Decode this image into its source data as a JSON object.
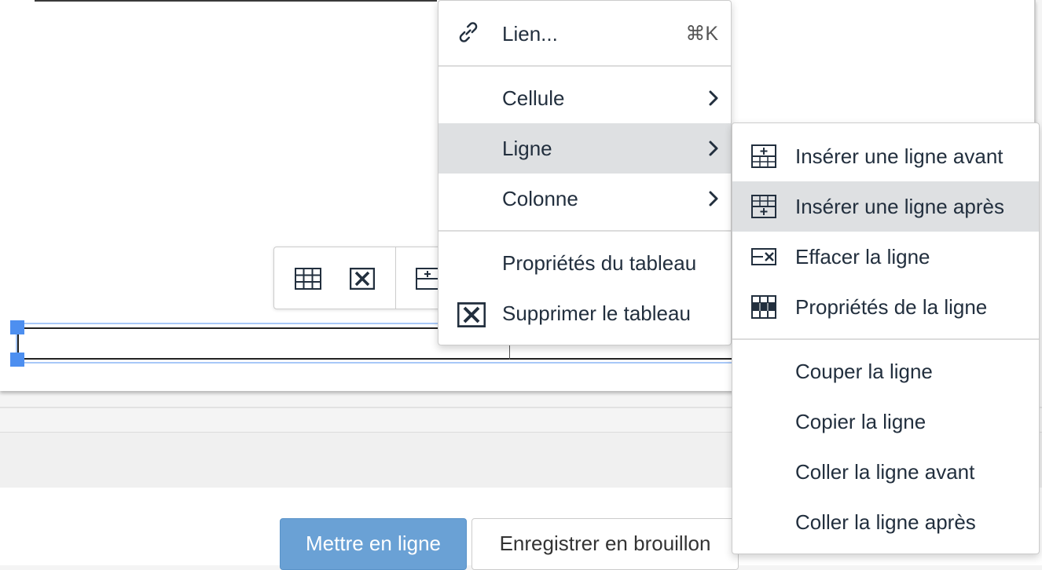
{
  "context_menu": {
    "link": {
      "label": "Lien...",
      "shortcut": "⌘K",
      "icon": "link-icon"
    },
    "cell": {
      "label": "Cellule"
    },
    "row": {
      "label": "Ligne"
    },
    "column": {
      "label": "Colonne"
    },
    "table_properties": {
      "label": "Propriétés du tableau"
    },
    "delete_table": {
      "label": "Supprimer le tableau",
      "icon": "table-delete-icon"
    }
  },
  "row_submenu": {
    "insert_before": {
      "label": "Insérer une ligne avant",
      "icon": "row-insert-before-icon"
    },
    "insert_after": {
      "label": "Insérer une ligne après",
      "icon": "row-insert-after-icon"
    },
    "delete_row": {
      "label": "Effacer la ligne",
      "icon": "row-delete-icon"
    },
    "row_properties": {
      "label": "Propriétés de la ligne",
      "icon": "row-properties-icon"
    },
    "cut_row": {
      "label": "Couper la ligne"
    },
    "copy_row": {
      "label": "Copier la ligne"
    },
    "paste_before": {
      "label": "Coller la ligne avant"
    },
    "paste_after": {
      "label": "Coller la ligne après"
    }
  },
  "table_toolbar": {
    "icons": [
      "table-properties-icon",
      "table-delete-icon",
      "row-insert-before-icon"
    ]
  },
  "footer": {
    "publish_label": "Mettre en ligne",
    "draft_label": "Enregistrer en brouillon"
  },
  "colors": {
    "accent": "#6aa1d5",
    "selection": "#4d8ff0",
    "hover": "#dee0e2"
  }
}
